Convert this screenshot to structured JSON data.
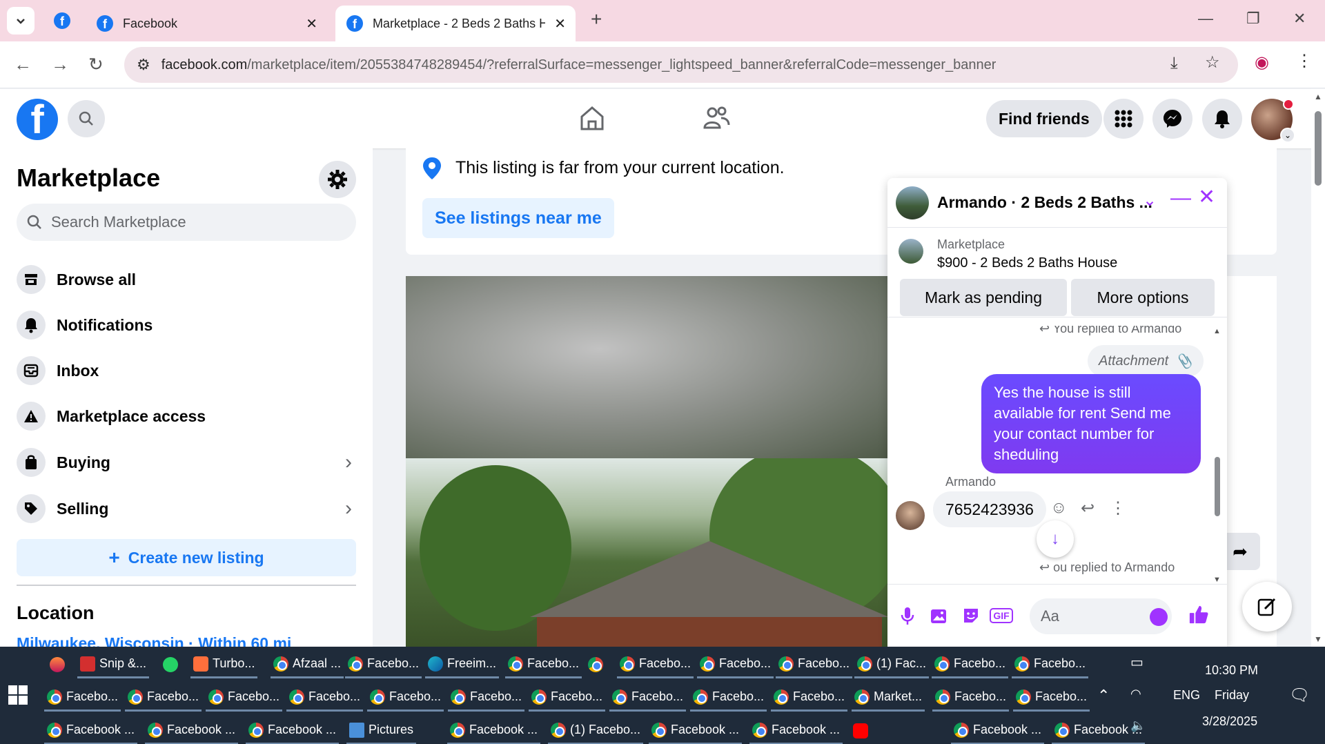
{
  "browser": {
    "tabs": [
      {
        "label": "Facebook"
      },
      {
        "label": "Marketplace - 2 Beds 2 Baths H"
      }
    ],
    "url_host": "facebook.com",
    "url_rest": "/marketplace/item/2055384748289454/?referralSurface=messenger_lightspeed_banner&referralCode=messenger_banner"
  },
  "header": {
    "logo": "f",
    "find_friends": "Find friends"
  },
  "sidebar": {
    "title": "Marketplace",
    "search_placeholder": "Search Marketplace",
    "items": [
      {
        "label": "Browse all",
        "icon": "storefront-icon"
      },
      {
        "label": "Notifications",
        "icon": "bell-icon"
      },
      {
        "label": "Inbox",
        "icon": "inbox-icon"
      },
      {
        "label": "Marketplace access",
        "icon": "warning-icon"
      },
      {
        "label": "Buying",
        "icon": "bag-icon"
      },
      {
        "label": "Selling",
        "icon": "tag-icon"
      }
    ],
    "create_listing": "Create new listing",
    "location_heading": "Location",
    "location_value": "Milwaukee, Wisconsin · Within 60 mi"
  },
  "notice": {
    "text": "This listing is far from your current location.",
    "button": "See listings near me"
  },
  "chat": {
    "title": "Armando · 2 Beds 2 Baths ...",
    "listing_category": "Marketplace",
    "listing_title": "$900 - 2 Beds 2 Baths House",
    "mark_pending": "Mark as pending",
    "more_options": "More options",
    "replied_top": "You replied to Armando",
    "attachment": "Attachment",
    "outgoing": "Yes the house is still available for rent Send me your contact number for sheduling",
    "sender": "Armando",
    "incoming": "7652423936",
    "replied_bottom": "ou replied to Armando",
    "input_placeholder": "Aa"
  },
  "taskbar": {
    "row1": [
      {
        "label": "",
        "icon": "flame"
      },
      {
        "label": "Snip &...",
        "icon": "snip"
      },
      {
        "label": "",
        "icon": "wa"
      },
      {
        "label": "Turbo...",
        "icon": "turbo"
      },
      {
        "label": "Afzaal ...",
        "icon": "chrome"
      },
      {
        "label": "Facebo...",
        "icon": "chrome"
      },
      {
        "label": "Freeim...",
        "icon": "edge"
      },
      {
        "label": "Facebo...",
        "icon": "chrome"
      },
      {
        "label": "",
        "icon": "chrome"
      },
      {
        "label": "Facebo...",
        "icon": "chrome"
      },
      {
        "label": "Facebo...",
        "icon": "chrome"
      },
      {
        "label": "Facebo...",
        "icon": "chrome"
      },
      {
        "label": "(1) Fac...",
        "icon": "chrome"
      },
      {
        "label": "Facebo...",
        "icon": "chrome"
      },
      {
        "label": "Facebo...",
        "icon": "chrome"
      }
    ],
    "row2": [
      {
        "label": "Facebo...",
        "icon": "chrome"
      },
      {
        "label": "Facebo...",
        "icon": "chrome"
      },
      {
        "label": "Facebo...",
        "icon": "chrome"
      },
      {
        "label": "Facebo...",
        "icon": "chrome"
      },
      {
        "label": "Facebo...",
        "icon": "chrome"
      },
      {
        "label": "Facebo...",
        "icon": "chrome"
      },
      {
        "label": "Facebo...",
        "icon": "chrome"
      },
      {
        "label": "Facebo...",
        "icon": "chrome"
      },
      {
        "label": "Facebo...",
        "icon": "chrome"
      },
      {
        "label": "Facebo...",
        "icon": "chrome"
      },
      {
        "label": "Market...",
        "icon": "chrome"
      },
      {
        "label": "Facebo...",
        "icon": "chrome"
      },
      {
        "label": "Facebo...",
        "icon": "chrome"
      }
    ],
    "row3": [
      {
        "label": "Facebook ...",
        "icon": "chrome"
      },
      {
        "label": "Facebook ...",
        "icon": "chrome"
      },
      {
        "label": "Facebook ...",
        "icon": "chrome"
      },
      {
        "label": "Pictures",
        "icon": "pics"
      },
      {
        "label": "Facebook ...",
        "icon": "chrome"
      },
      {
        "label": "(1) Facebo...",
        "icon": "chrome"
      },
      {
        "label": "Facebook ...",
        "icon": "chrome"
      },
      {
        "label": "Facebook ...",
        "icon": "chrome"
      },
      {
        "label": "",
        "icon": "yt"
      },
      {
        "label": "Facebook ...",
        "icon": "chrome"
      },
      {
        "label": "Facebook ...",
        "icon": "chrome"
      }
    ],
    "language": "ENG",
    "time": "10:30 PM",
    "day": "Friday",
    "date": "3/28/2025"
  }
}
